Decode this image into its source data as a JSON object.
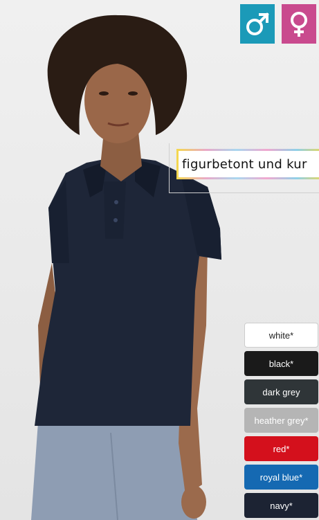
{
  "gender_toggle": {
    "male_icon": "male-symbol-icon",
    "female_icon": "female-symbol-icon",
    "male_color": "#1b9ab8",
    "female_color": "#c94a8e"
  },
  "feature_label": "figurbetont und kur",
  "colors": [
    {
      "label": "white*",
      "bg": "#ffffff",
      "fg": "#222222"
    },
    {
      "label": "black*",
      "bg": "#1a1a1a",
      "fg": "#ffffff"
    },
    {
      "label": "dark grey",
      "bg": "#2f3538",
      "fg": "#ffffff"
    },
    {
      "label": "heather grey*",
      "bg": "#b5b5b5",
      "fg": "#ffffff"
    },
    {
      "label": "red*",
      "bg": "#d4101c",
      "fg": "#ffffff"
    },
    {
      "label": "royal blue*",
      "bg": "#1569b2",
      "fg": "#ffffff"
    },
    {
      "label": "navy*",
      "bg": "#1c2333",
      "fg": "#ffffff"
    }
  ]
}
